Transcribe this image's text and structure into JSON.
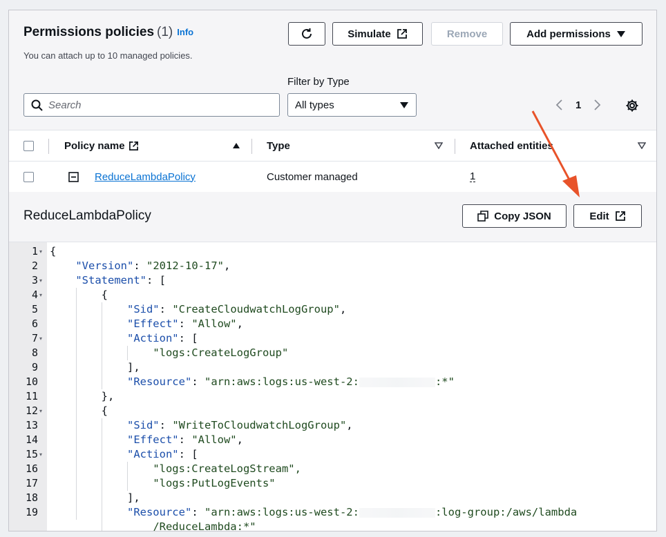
{
  "header": {
    "title": "Permissions policies",
    "count": "(1)",
    "info_link": "Info",
    "description": "You can attach up to 10 managed policies."
  },
  "toolbar": {
    "simulate_label": "Simulate",
    "remove_label": "Remove",
    "add_permissions_label": "Add permissions"
  },
  "filters": {
    "filter_label": "Filter by Type",
    "search_placeholder": "Search",
    "type_selected": "All types"
  },
  "pagination": {
    "current_page": "1"
  },
  "table": {
    "columns": [
      "Policy name",
      "Type",
      "Attached entities"
    ],
    "rows": [
      {
        "policy_name": "ReduceLambdaPolicy",
        "type": "Customer managed",
        "attached_entities": "1"
      }
    ]
  },
  "detail": {
    "title": "ReduceLambdaPolicy",
    "copy_json_label": "Copy JSON",
    "edit_label": "Edit"
  },
  "code": {
    "line_numbers": [
      "1",
      "2",
      "3",
      "4",
      "5",
      "6",
      "7",
      "8",
      "9",
      "10",
      "11",
      "12",
      "13",
      "14",
      "15",
      "16",
      "17",
      "18",
      "19"
    ],
    "lines": [
      "{",
      "    \"Version\": \"2012-10-17\",",
      "    \"Statement\": [",
      "        {",
      "            \"Sid\": \"CreateCloudwatchLogGroup\",",
      "            \"Effect\": \"Allow\",",
      "            \"Action\": [",
      "                \"logs:CreateLogGroup\"",
      "            ],",
      "            \"Resource\": \"arn:aws:logs:us-west-2:            :*\"",
      "        },",
      "        {",
      "            \"Sid\": \"WriteToCloudwatchLogGroup\",",
      "            \"Effect\": \"Allow\",",
      "            \"Action\": [",
      "                \"logs:CreateLogStream\",",
      "                \"logs:PutLogEvents\"",
      "            ],",
      "            \"Resource\": \"arn:aws:logs:us-west-2:            :log-group:/aws/lambda",
      "                /ReduceLambda:*\""
    ]
  },
  "colors": {
    "link": "#0972d3",
    "arrow": "#e8532a",
    "code_key": "#1b4eaa"
  },
  "icons": [
    "refresh-icon",
    "external-link-icon",
    "caret-down-icon",
    "search-icon",
    "chevron-left-icon",
    "chevron-right-icon",
    "gear-icon",
    "sort-asc-icon",
    "collapse-icon",
    "copy-icon"
  ]
}
